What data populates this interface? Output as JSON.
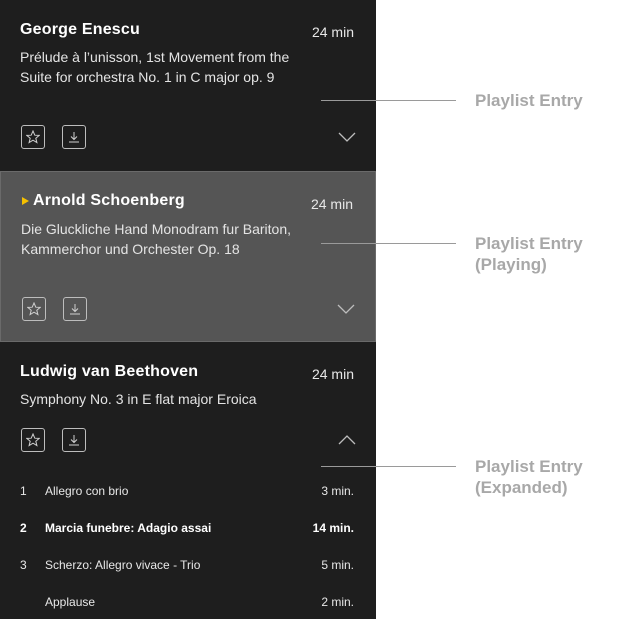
{
  "entries": [
    {
      "composer": "George Enescu",
      "duration": "24 min",
      "work": "Prélude à l’unisson, 1st Movement from the Suite for orchestra No. 1 in C major op. 9"
    },
    {
      "composer": "Arnold Schoenberg",
      "duration": "24 min",
      "work": "Die Gluckliche Hand Monodram fur Bariton, Kammerchor und Orchester Op. 18"
    },
    {
      "composer": "Ludwig van Beethoven",
      "duration": "24 min",
      "work": "Symphony No. 3 in E flat major Eroica",
      "tracks": [
        {
          "num": "1",
          "title": "Allegro con brio",
          "length": "3 min."
        },
        {
          "num": "2",
          "title": "Marcia funebre: Adagio assai",
          "length": "14 min."
        },
        {
          "num": "3",
          "title": "Scherzo: Allegro vivace - Trio",
          "length": "5 min."
        },
        {
          "num": "",
          "title": "Applause",
          "length": "2 min."
        }
      ]
    }
  ],
  "callouts": {
    "entry": "Playlist Entry",
    "playing_1": "Playlist Entry",
    "playing_2": "(Playing)",
    "expanded_1": "Playlist Entry",
    "expanded_2": "(Expanded)"
  },
  "colors": {
    "panel": "#1e1e1e",
    "playing_bg": "#555555",
    "play_indicator": "#f5c000",
    "callout": "#a8a8a8"
  }
}
